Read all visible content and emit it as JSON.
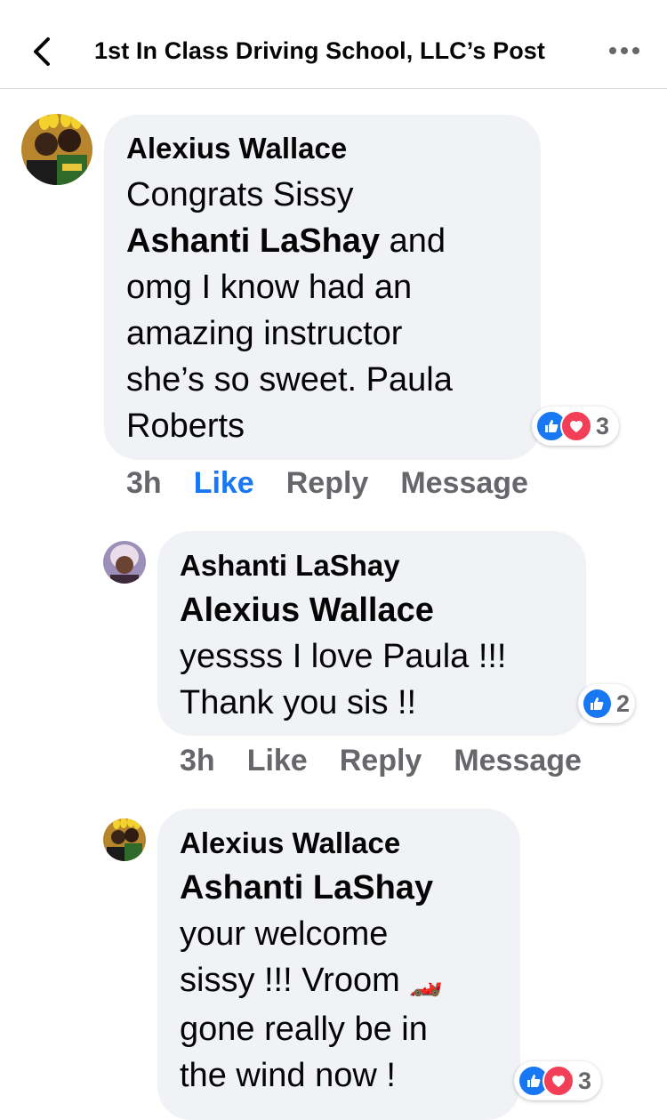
{
  "header": {
    "title": "1st In Class Driving School, LLC’s Post"
  },
  "comments": [
    {
      "author": "Alexius Wallace",
      "text_lead": "Congrats Sissy",
      "mention": "Ashanti LaShay",
      "text_rest_1": " and",
      "lines": [
        "omg I know had an",
        "amazing instructor",
        "she’s so sweet.  Paula",
        "Roberts"
      ],
      "reaction_count": "3",
      "time": "3h",
      "like": "Like",
      "reply": "Reply",
      "message": "Message"
    },
    {
      "author": "Ashanti LaShay",
      "mention": "Alexius Wallace",
      "lines": [
        "yessss I love Paula !!!",
        "Thank you sis !!"
      ],
      "reaction_count": "2",
      "time": "3h",
      "like": "Like",
      "reply": "Reply",
      "message": "Message"
    },
    {
      "author": "Alexius Wallace",
      "mention": "Ashanti LaShay",
      "lines": [
        "your welcome",
        "sissy !!! Vroom",
        "gone really be in",
        "the wind now !"
      ],
      "emoji": "🏎️",
      "reaction_count": "3"
    }
  ],
  "colors": {
    "accent": "#1877f2",
    "love": "#f33e58",
    "bubble": "#f0f2f5",
    "muted": "#65676b"
  }
}
